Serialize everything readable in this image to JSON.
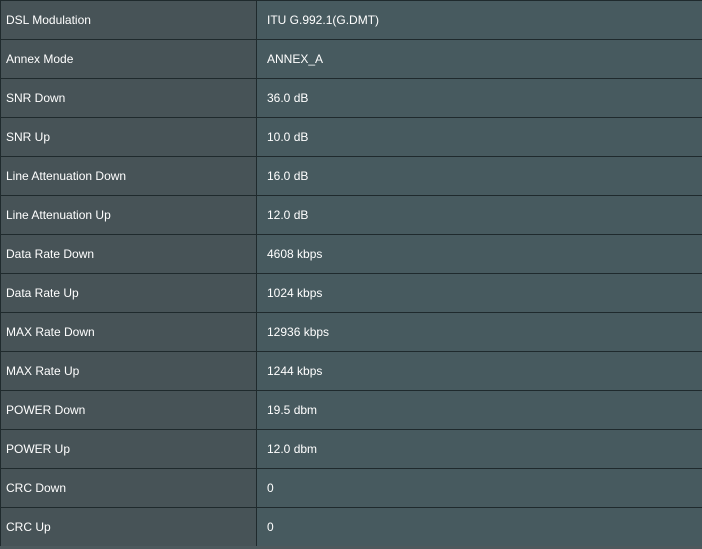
{
  "rows": [
    {
      "label": "DSL Modulation",
      "value": "ITU G.992.1(G.DMT)"
    },
    {
      "label": "Annex Mode",
      "value": "ANNEX_A"
    },
    {
      "label": "SNR Down",
      "value": "36.0 dB"
    },
    {
      "label": "SNR Up",
      "value": "10.0 dB"
    },
    {
      "label": "Line Attenuation Down",
      "value": "16.0 dB"
    },
    {
      "label": "Line Attenuation Up",
      "value": "12.0 dB"
    },
    {
      "label": "Data Rate Down",
      "value": "4608 kbps"
    },
    {
      "label": "Data Rate Up",
      "value": "1024 kbps"
    },
    {
      "label": "MAX Rate Down",
      "value": "12936 kbps"
    },
    {
      "label": "MAX Rate Up",
      "value": "1244 kbps"
    },
    {
      "label": "POWER Down",
      "value": "19.5 dbm"
    },
    {
      "label": "POWER Up",
      "value": "12.0 dbm"
    },
    {
      "label": "CRC Down",
      "value": "0"
    },
    {
      "label": "CRC Up",
      "value": "0"
    }
  ]
}
